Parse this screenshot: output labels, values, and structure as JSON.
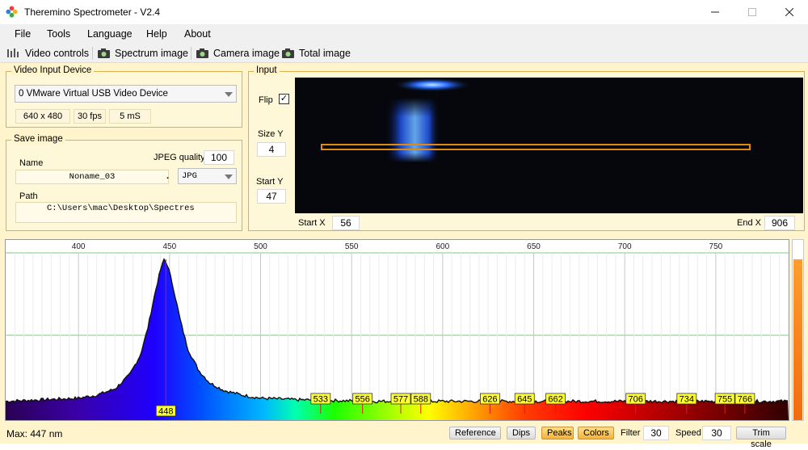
{
  "window": {
    "title": "Theremino Spectrometer - V2.4"
  },
  "menu": [
    "File",
    "Tools",
    "Language",
    "Help",
    "About"
  ],
  "toolbar": {
    "video_controls": "Video controls",
    "spectrum_image": "Spectrum image",
    "camera_image": "Camera image",
    "total_image": "Total image"
  },
  "video_input": {
    "title": "Video Input Device",
    "device": "0 VMware Virtual USB Video Device",
    "resolution": "640 x 480",
    "fps": "30 fps",
    "exposure": "5 mS"
  },
  "save_image": {
    "title": "Save image",
    "name_label": "Name",
    "name_value": "Noname_03",
    "dot": ".",
    "jpeg_label": "JPEG quality",
    "jpeg_value": "100",
    "format": "JPG",
    "path_label": "Path",
    "path_value": "C:\\Users\\mac\\Desktop\\Spectres"
  },
  "input": {
    "title": "Input",
    "flip_label": "Flip",
    "flip_checked": "✓",
    "size_y_label": "Size Y",
    "size_y_value": "4",
    "start_y_label": "Start Y",
    "start_y_value": "47",
    "start_x_label": "Start X",
    "start_x_value": "56",
    "end_x_label": "End X",
    "end_x_value": "906"
  },
  "chart_data": {
    "type": "line",
    "x_ticks": [
      400,
      450,
      500,
      550,
      600,
      650,
      700,
      750
    ],
    "xlim": [
      360,
      790
    ],
    "peaks": [
      448,
      533,
      556,
      577,
      588,
      626,
      645,
      662,
      706,
      734,
      755,
      766
    ],
    "main_peak_nm": 447,
    "spectrum_x": [
      360,
      380,
      400,
      410,
      420,
      428,
      434,
      438,
      442,
      445,
      447,
      449,
      452,
      456,
      460,
      466,
      472,
      480,
      490,
      500,
      520,
      540,
      560,
      600,
      640,
      680,
      720,
      760,
      790
    ],
    "spectrum_y": [
      0.08,
      0.09,
      0.1,
      0.12,
      0.16,
      0.25,
      0.38,
      0.55,
      0.78,
      0.93,
      1.0,
      0.96,
      0.82,
      0.6,
      0.42,
      0.28,
      0.2,
      0.15,
      0.12,
      0.1,
      0.09,
      0.085,
      0.08,
      0.08,
      0.08,
      0.08,
      0.08,
      0.08,
      0.08
    ]
  },
  "status": {
    "max_text": "Max: 447 nm",
    "reference": "Reference",
    "dips": "Dips",
    "peaks": "Peaks",
    "colors": "Colors",
    "filter_label": "Filter",
    "filter_value": "30",
    "speed_label": "Speed",
    "speed_value": "30",
    "trim_scale": "Trim scale"
  }
}
